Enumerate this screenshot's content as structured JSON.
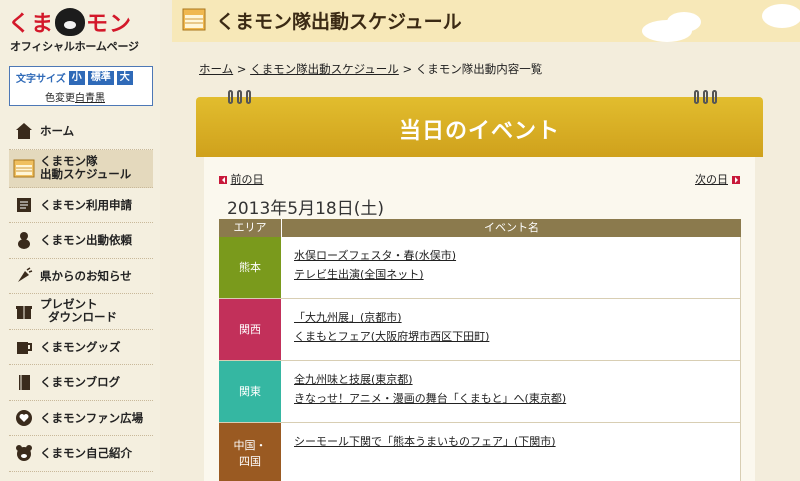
{
  "logo": {
    "main_pre": "くま",
    "main_post": "モン",
    "sub": "オフィシャルホームページ"
  },
  "font_size": {
    "label": "文字サイズ",
    "small": "小",
    "standard": "標準",
    "large": "大",
    "color_change": "色変更",
    "white": "白",
    "blue": "青",
    "black": "黒"
  },
  "nav": {
    "items": [
      {
        "label": "ホーム",
        "icon": "house-icon"
      },
      {
        "label_line1": "くまモン隊",
        "label_line2": "出動スケジュール",
        "icon": "calendar-icon"
      },
      {
        "label": "くまモン利用申請",
        "icon": "document-icon"
      },
      {
        "label": "くまモン出動依頼",
        "icon": "bear-figure-icon"
      },
      {
        "label": "県からのお知らせ",
        "icon": "announcement-icon"
      },
      {
        "label_line1": "プレゼント",
        "label_line2": "ダウンロード",
        "icon": "present-icon"
      },
      {
        "label": "くまモングッズ",
        "icon": "mug-icon"
      },
      {
        "label": "くまモンブログ",
        "icon": "book-icon"
      },
      {
        "label": "くまモンファン広場",
        "icon": "heart-icon"
      },
      {
        "label": "くまモン自己紹介",
        "icon": "bear-face-icon"
      }
    ]
  },
  "header": {
    "title": "くまモン隊出動スケジュール"
  },
  "breadcrumb": {
    "home": "ホーム",
    "sep1": " > ",
    "schedule": "くまモン隊出動スケジュール",
    "sep2": " > ",
    "current": "くまモン隊出動内容一覧"
  },
  "banner": {
    "title": "当日のイベント"
  },
  "day_nav": {
    "prev": "前の日",
    "next": "次の日"
  },
  "date": "2013年5月18日(土)",
  "table": {
    "col_area": "エリア",
    "col_event": "イベント名",
    "rows": [
      {
        "area": "熊本",
        "area_line2": "",
        "color": "#7a9a1c",
        "events": [
          "水俣ローズフェスタ・春(水俣市)",
          "テレビ生出演(全国ネット)"
        ]
      },
      {
        "area": "関西",
        "area_line2": "",
        "color": "#c2305a",
        "events": [
          "「大九州展」(京都市)",
          "くまもとフェア(大阪府堺市西区下田町)"
        ]
      },
      {
        "area": "関東",
        "area_line2": "",
        "color": "#35b7a2",
        "events": [
          "全九州味と技展(東京都)",
          "きなっせ！アニメ・漫画の舞台「くまもと」へ(東京都)"
        ]
      },
      {
        "area": "中国・",
        "area_line2": "四国",
        "color": "#9a5a22",
        "events": [
          "シーモール下関で「熊本うまいものフェア」(下関市)"
        ]
      }
    ]
  },
  "colors": {
    "accent_red": "#d3182a",
    "banner_gold": "#cfa11c",
    "header_bg": "#f7e8b8"
  }
}
